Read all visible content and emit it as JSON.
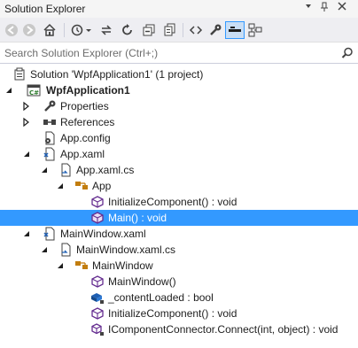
{
  "window": {
    "title": "Solution Explorer"
  },
  "search": {
    "placeholder": "Search Solution Explorer (Ctrl+;)"
  },
  "toolbar": {
    "icons": [
      "back-icon",
      "forward-icon",
      "home-icon",
      "history-icon",
      "sync-icon",
      "refresh-icon",
      "collapse-all-icon",
      "show-all-files-icon",
      "view-code-icon",
      "properties-icon",
      "preview-selected-icon",
      "class-diagram-icon"
    ]
  },
  "colors": {
    "selection": "#3399ff",
    "toolbar_bg": "#eeeef2",
    "accent_purple": "#652d90",
    "accent_blue": "#1e5fb4",
    "accent_orange": "#c27d0e"
  },
  "tree": {
    "solution": "Solution 'WpfApplication1' (1 project)",
    "project": "WpfApplication1",
    "properties": "Properties",
    "references": "References",
    "app_config": "App.config",
    "app_xaml": "App.xaml",
    "app_xaml_cs": "App.xaml.cs",
    "app_class": "App",
    "initialize_component_1": "InitializeComponent() : void",
    "main": "Main() : void",
    "mainwindow_xaml": "MainWindow.xaml",
    "mainwindow_xaml_cs": "MainWindow.xaml.cs",
    "mainwindow_class": "MainWindow",
    "mainwindow_ctor": "MainWindow()",
    "content_loaded": "_contentLoaded : bool",
    "initialize_component_2": "InitializeComponent() : void",
    "connect": "IComponentConnector.Connect(int, object) : void"
  }
}
